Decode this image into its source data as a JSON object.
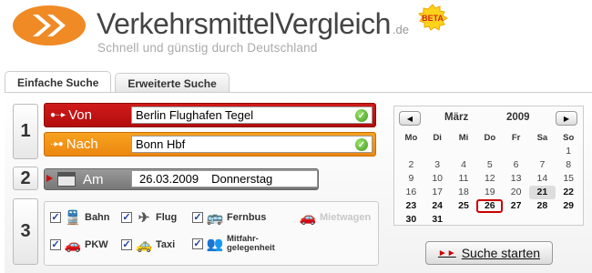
{
  "brand": {
    "part1": "Verkehrsmittel",
    "part2": "Vergleich",
    "tld": ".de",
    "tagline": "Schnell und günstig durch Deutschland",
    "badge": "BETA"
  },
  "tabs": [
    {
      "label": "Einfache Suche",
      "active": true
    },
    {
      "label": "Erweiterte Suche",
      "active": false
    }
  ],
  "steps": [
    "1",
    "2",
    "3"
  ],
  "route": {
    "von": {
      "label": "Von",
      "value": "Berlin Flughafen Tegel"
    },
    "nach": {
      "label": "Nach",
      "value": "Bonn Hbf"
    }
  },
  "date": {
    "label": "Am",
    "value": "26.03.2009",
    "weekday": "Donnerstag"
  },
  "transport": [
    {
      "label": "Bahn",
      "checked": true,
      "icon": "train-icon"
    },
    {
      "label": "Flug",
      "checked": true,
      "icon": "plane-icon"
    },
    {
      "label": "Fernbus",
      "checked": true,
      "icon": "bus-icon"
    },
    {
      "label": "Mietwagen",
      "checked": false,
      "disabled": true,
      "icon": "car-icon"
    },
    {
      "label": "PKW",
      "checked": true,
      "icon": "car-icon"
    },
    {
      "label": "Taxi",
      "checked": true,
      "icon": "taxi-icon"
    },
    {
      "label": "Mitfahr-",
      "label2": "gelegenheit",
      "checked": true,
      "icon": "people-icon"
    }
  ],
  "calendar": {
    "month": "März",
    "year": "2009",
    "prev": "◀",
    "next": "▶",
    "weekdays": [
      "Mo",
      "Di",
      "Mi",
      "Do",
      "Fr",
      "Sa",
      "So"
    ],
    "weeks": [
      [
        "",
        "",
        "",
        "",
        "",
        "",
        "1"
      ],
      [
        "2",
        "3",
        "4",
        "5",
        "6",
        "7",
        "8"
      ],
      [
        "9",
        "10",
        "11",
        "12",
        "13",
        "14",
        "15"
      ],
      [
        "16",
        "17",
        "18",
        "19",
        "20",
        "21",
        "22"
      ],
      [
        "23",
        "24",
        "25",
        "26",
        "27",
        "28",
        "29"
      ],
      [
        "30",
        "31",
        "",
        "",
        "",
        "",
        ""
      ]
    ],
    "today": "21",
    "selected": "26"
  },
  "search_button": {
    "label": "Suche starten",
    "arrow": "►►"
  },
  "colors": {
    "von": "#c41414",
    "nach": "#f09414",
    "am": "#888888",
    "accent": "#cc0000"
  }
}
